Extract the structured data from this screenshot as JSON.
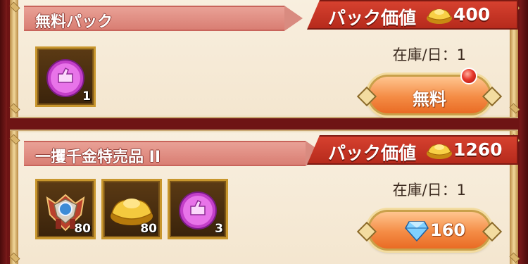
{
  "packs": [
    {
      "title": "無料パック",
      "value_label": "パック価値",
      "value_amount": "400",
      "stock_label": "在庫/日：1",
      "items": [
        {
          "icon": "pink-coin-icon",
          "count": "1"
        }
      ],
      "button_label": "無料",
      "has_notification": true
    },
    {
      "title": "一攫千金特売品 II",
      "value_label": "パック価値",
      "value_amount": "1260",
      "stock_label": "在庫/日：1",
      "items": [
        {
          "icon": "emblem-icon",
          "count": "80"
        },
        {
          "icon": "gold-ingot-icon",
          "count": "80"
        },
        {
          "icon": "pink-coin-icon",
          "count": "3"
        }
      ],
      "button_price": "160",
      "button_icon": "diamond-icon"
    }
  ],
  "colors": {
    "banner_red": "#c8311f",
    "ribbon": "#e29a8d",
    "button_orange": "#f48c45",
    "gold_border": "#c8962d"
  }
}
